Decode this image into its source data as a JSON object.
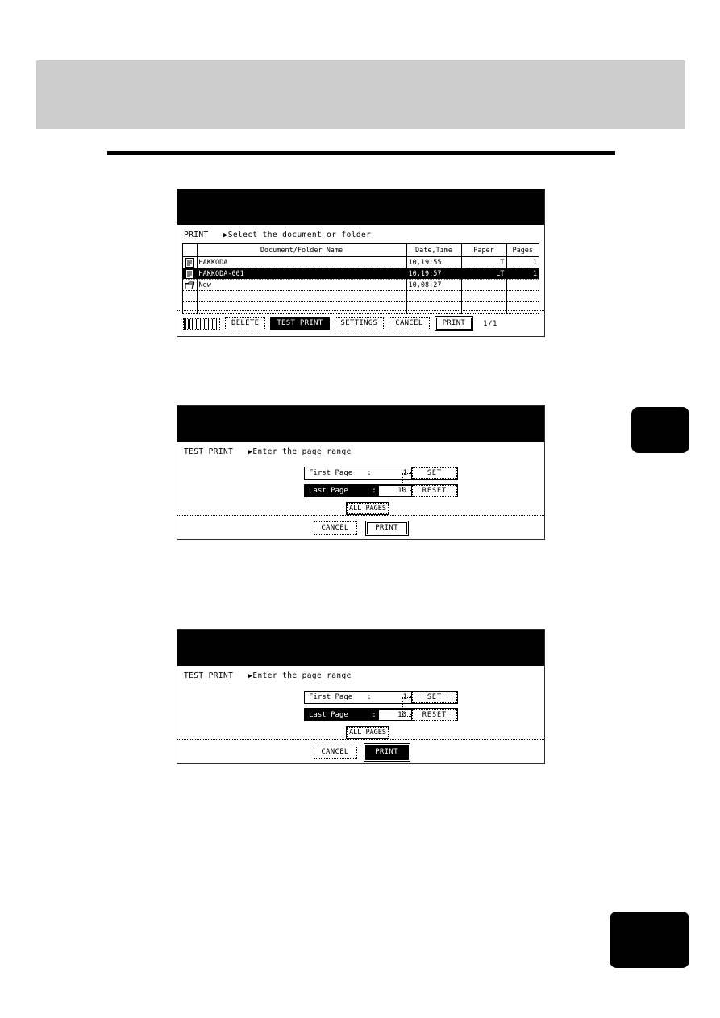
{
  "page": {
    "header_band": "",
    "side_tabs": [
      {
        "name": "upper-chapter-tab",
        "label": ""
      },
      {
        "name": "lower-chapter-tab",
        "label": ""
      }
    ]
  },
  "panels": [
    {
      "id": "print-select",
      "crumb_title": "PRINT",
      "crumb_arrow": "▶",
      "crumb_text": "Select the document or folder",
      "table": {
        "headers": [
          "",
          "Document/Folder Name",
          "Date,Time",
          "Paper",
          "Pages"
        ],
        "rows": [
          {
            "icon": "document-icon",
            "name": "HAKKODA",
            "date": "10,19:55",
            "paper": "LT",
            "pages": "1",
            "selected": false
          },
          {
            "icon": "document-icon",
            "name": "HAKKODA-001",
            "date": "10,19:57",
            "paper": "LT",
            "pages": "1",
            "selected": true
          },
          {
            "icon": "folder-icon",
            "name": "New",
            "date": "10,08:27",
            "paper": "",
            "pages": "",
            "selected": false
          },
          {
            "icon": "",
            "name": "",
            "date": "",
            "paper": "",
            "pages": "",
            "selected": false
          },
          {
            "icon": "",
            "name": "",
            "date": "",
            "paper": "",
            "pages": "",
            "selected": false
          }
        ]
      },
      "buttons": [
        {
          "name": "unreadable-button",
          "label": "",
          "style": "garbled"
        },
        {
          "name": "delete-button",
          "label": "DELETE",
          "style": "dotted"
        },
        {
          "name": "test-print-button",
          "label": "TEST PRINT",
          "style": "inverted"
        },
        {
          "name": "settings-button",
          "label": "SETTINGS",
          "style": "dotted"
        },
        {
          "name": "cancel-button",
          "label": "CANCEL",
          "style": "dotted"
        },
        {
          "name": "print-button",
          "label": "PRINT",
          "style": "double"
        }
      ],
      "page_indicator": "1/1"
    },
    {
      "id": "test-print-range-1",
      "crumb_title": "TEST PRINT",
      "crumb_arrow": "▶",
      "crumb_text": "Enter the page range",
      "fields": [
        {
          "name": "first-page-field",
          "label": "First Page",
          "colon": ":",
          "value": "1",
          "active": false
        },
        {
          "name": "last-page-field",
          "label": "Last Page",
          "colon": ":",
          "value": "10",
          "active": true
        }
      ],
      "side_buttons": [
        {
          "name": "set-button",
          "label": "SET"
        },
        {
          "name": "reset-button",
          "label": "RESET"
        }
      ],
      "all_pages_label": "ALL PAGES",
      "foot_buttons": [
        {
          "name": "cancel-button",
          "label": "CANCEL",
          "style": "dotted"
        },
        {
          "name": "print-button",
          "label": "PRINT",
          "style": "double"
        }
      ]
    },
    {
      "id": "test-print-range-2",
      "crumb_title": "TEST PRINT",
      "crumb_arrow": "▶",
      "crumb_text": "Enter the page range",
      "fields": [
        {
          "name": "first-page-field",
          "label": "First Page",
          "colon": ":",
          "value": "1",
          "active": false
        },
        {
          "name": "last-page-field",
          "label": "Last Page",
          "colon": ":",
          "value": "10",
          "active": true
        }
      ],
      "side_buttons": [
        {
          "name": "set-button",
          "label": "SET"
        },
        {
          "name": "reset-button",
          "label": "RESET"
        }
      ],
      "all_pages_label": "ALL PAGES",
      "foot_buttons": [
        {
          "name": "cancel-button",
          "label": "CANCEL",
          "style": "dotted"
        },
        {
          "name": "print-button",
          "label": "PRINT",
          "style": "inverted-double"
        }
      ]
    }
  ],
  "colors": {
    "lcd_background": "#ffffff",
    "lcd_foreground": "#000000",
    "header_band": "#cdcdcd",
    "tab": "#000000"
  }
}
